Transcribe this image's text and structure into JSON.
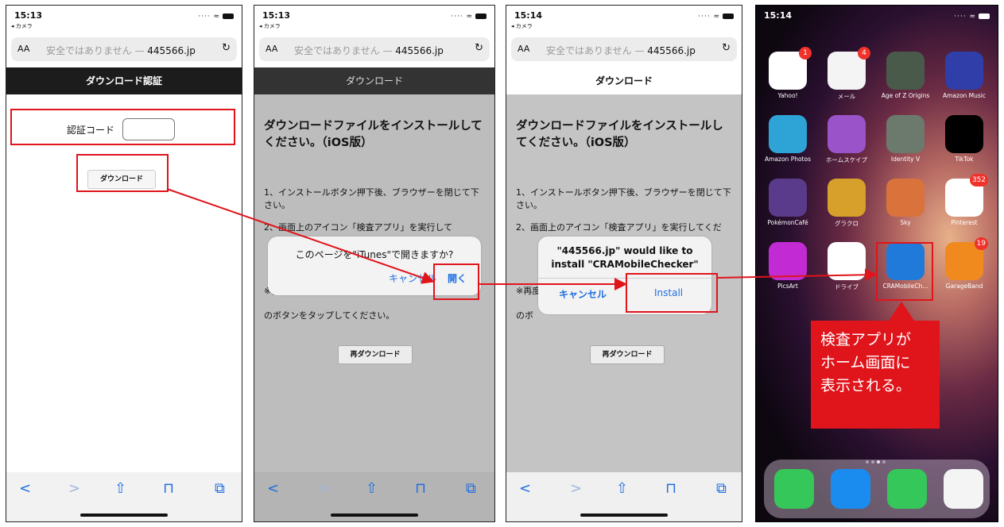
{
  "common": {
    "back_label": "◂ カメラ",
    "aa": "AA",
    "url_insecure": "安全ではありません — ",
    "url_domain": "445566.jp",
    "nav_icons": [
      "back-icon",
      "forward-icon",
      "share-icon",
      "bookmarks-icon",
      "tabs-icon"
    ]
  },
  "screen1": {
    "time": "15:13",
    "title": "ダウンロード認証",
    "code_label": "認証コード",
    "download_button": "ダウンロード"
  },
  "screen2": {
    "time": "15:13",
    "title": "ダウンロード",
    "heading": "ダウンロードファイルをインストールしてください。（iOS版）",
    "para1": "1、インストールボタン押下後、ブラウザーを閉じて下さい。",
    "para2": "2、画面上のアイコン「検査アプリ」を実行して",
    "para3": "※再度",
    "para4": "のボタンをタップしてください。",
    "dialog_message": "このページを\"iTunes\"で開きますか?",
    "dialog_cancel": "キャンセル",
    "dialog_open": "開く",
    "redownload_button": "再ダウンロード"
  },
  "screen3": {
    "time": "15:14",
    "title": "ダウンロード",
    "heading": "ダウンロードファイルをインストールしてください。（iOS版）",
    "para1": "1、インストールボタン押下後、ブラウザーを閉じて下さい。",
    "para2": "2、画面上のアイコン「検査アプリ」を実行してくだ",
    "para3": "※再度",
    "para4": "のボ",
    "dialog_line1": "\"445566.jp\" would like to",
    "dialog_line2": "install \"CRAMobileChecker\"",
    "dialog_cancel": "キャンセル",
    "dialog_install": "Install",
    "redownload_button": "再ダウンロード"
  },
  "screen4": {
    "time": "15:14",
    "apps": [
      {
        "name": "Yahoo!",
        "badge": "1",
        "color": "#ffffff"
      },
      {
        "name": "メール",
        "badge": "4",
        "color": "#f4f4f4"
      },
      {
        "name": "Age of Z Origins",
        "badge": "",
        "color": "#4a5a4a"
      },
      {
        "name": "Amazon Music",
        "badge": "",
        "color": "#2f3ea8"
      },
      {
        "name": "Amazon Photos",
        "badge": "",
        "color": "#2ea3d6"
      },
      {
        "name": "ホームスケイプ",
        "badge": "",
        "color": "#9a53c9"
      },
      {
        "name": "Identity V",
        "badge": "",
        "color": "#6b7a6c"
      },
      {
        "name": "TikTok",
        "badge": "",
        "color": "#000000"
      },
      {
        "name": "PokémonCafé",
        "badge": "",
        "color": "#5a3a8a"
      },
      {
        "name": "グラクロ",
        "badge": "",
        "color": "#d6a02a"
      },
      {
        "name": "Sky",
        "badge": "",
        "color": "#d9733b"
      },
      {
        "name": "Pinterest",
        "badge": "352",
        "color": "#ffffff"
      },
      {
        "name": "PicsArt",
        "badge": "",
        "color": "#c22bd4"
      },
      {
        "name": "ドライブ",
        "badge": "",
        "color": "#ffffff"
      },
      {
        "name": "CRAMobileCh...",
        "badge": "",
        "color": "#1f7ad9"
      },
      {
        "name": "GarageBand",
        "badge": "19",
        "color": "#f08a1e"
      }
    ],
    "dock": [
      {
        "name": "phone-app",
        "color": "#35c759"
      },
      {
        "name": "safari-app",
        "color": "#1a8cf0"
      },
      {
        "name": "messages-app",
        "color": "#35c759"
      },
      {
        "name": "music-app",
        "color": "#f4f4f4"
      }
    ]
  },
  "callout": {
    "line1": "検査アプリが",
    "line2": "ホーム画面に",
    "line3": "表示される。"
  },
  "colors": {
    "highlight": "#e0141b",
    "ios_blue": "#1e6fe0"
  }
}
